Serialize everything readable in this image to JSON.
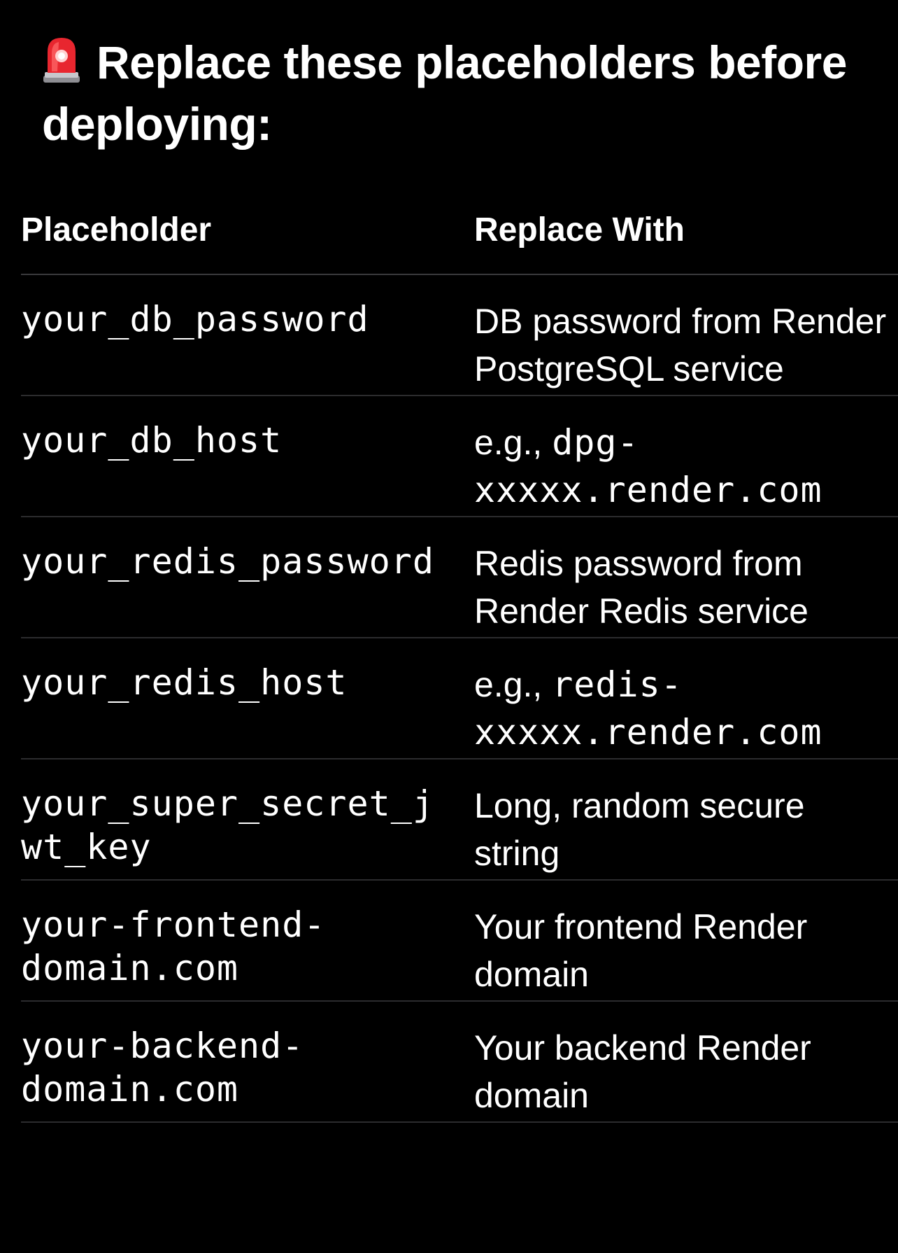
{
  "heading": {
    "icon": "siren-icon",
    "text": "Replace these placeholders before deploying:"
  },
  "table": {
    "headers": [
      "Placeholder",
      "Replace With"
    ],
    "rows": [
      {
        "placeholder": "your_db_password",
        "replace_lines": [
          {
            "text": "DB password from Render",
            "mono": false
          },
          {
            "text": "PostgreSQL service",
            "mono": false
          }
        ]
      },
      {
        "placeholder": "your_db_host",
        "replace_lines": [
          {
            "text": "e.g., ",
            "mono": false,
            "inline_mono": "dpg-"
          },
          {
            "text": "xxxxx.render.com",
            "mono": true
          }
        ]
      },
      {
        "placeholder": "your_redis_password",
        "replace_lines": [
          {
            "text": "Redis password from",
            "mono": false
          },
          {
            "text": "Render Redis service",
            "mono": false
          }
        ]
      },
      {
        "placeholder": "your_redis_host",
        "replace_lines": [
          {
            "text": "e.g., ",
            "mono": false,
            "inline_mono": "redis-"
          },
          {
            "text": "xxxxx.render.com",
            "mono": true
          }
        ]
      },
      {
        "placeholder": "your_super_secret_j\nwt_key",
        "replace_lines": [
          {
            "text": "Long, random secure",
            "mono": false
          },
          {
            "text": "string",
            "mono": false
          }
        ]
      },
      {
        "placeholder": "your-frontend-\ndomain.com",
        "replace_lines": [
          {
            "text": "Your frontend Render",
            "mono": false
          },
          {
            "text": "domain",
            "mono": false
          }
        ]
      },
      {
        "placeholder": "your-backend-\ndomain.com",
        "replace_lines": [
          {
            "text": "Your backend Render",
            "mono": false
          },
          {
            "text": "domain",
            "mono": false
          }
        ]
      }
    ]
  },
  "colors": {
    "background": "#000000",
    "text": "#ffffff",
    "divider": "#2c2c2e",
    "siren_red": "#e8262f"
  }
}
